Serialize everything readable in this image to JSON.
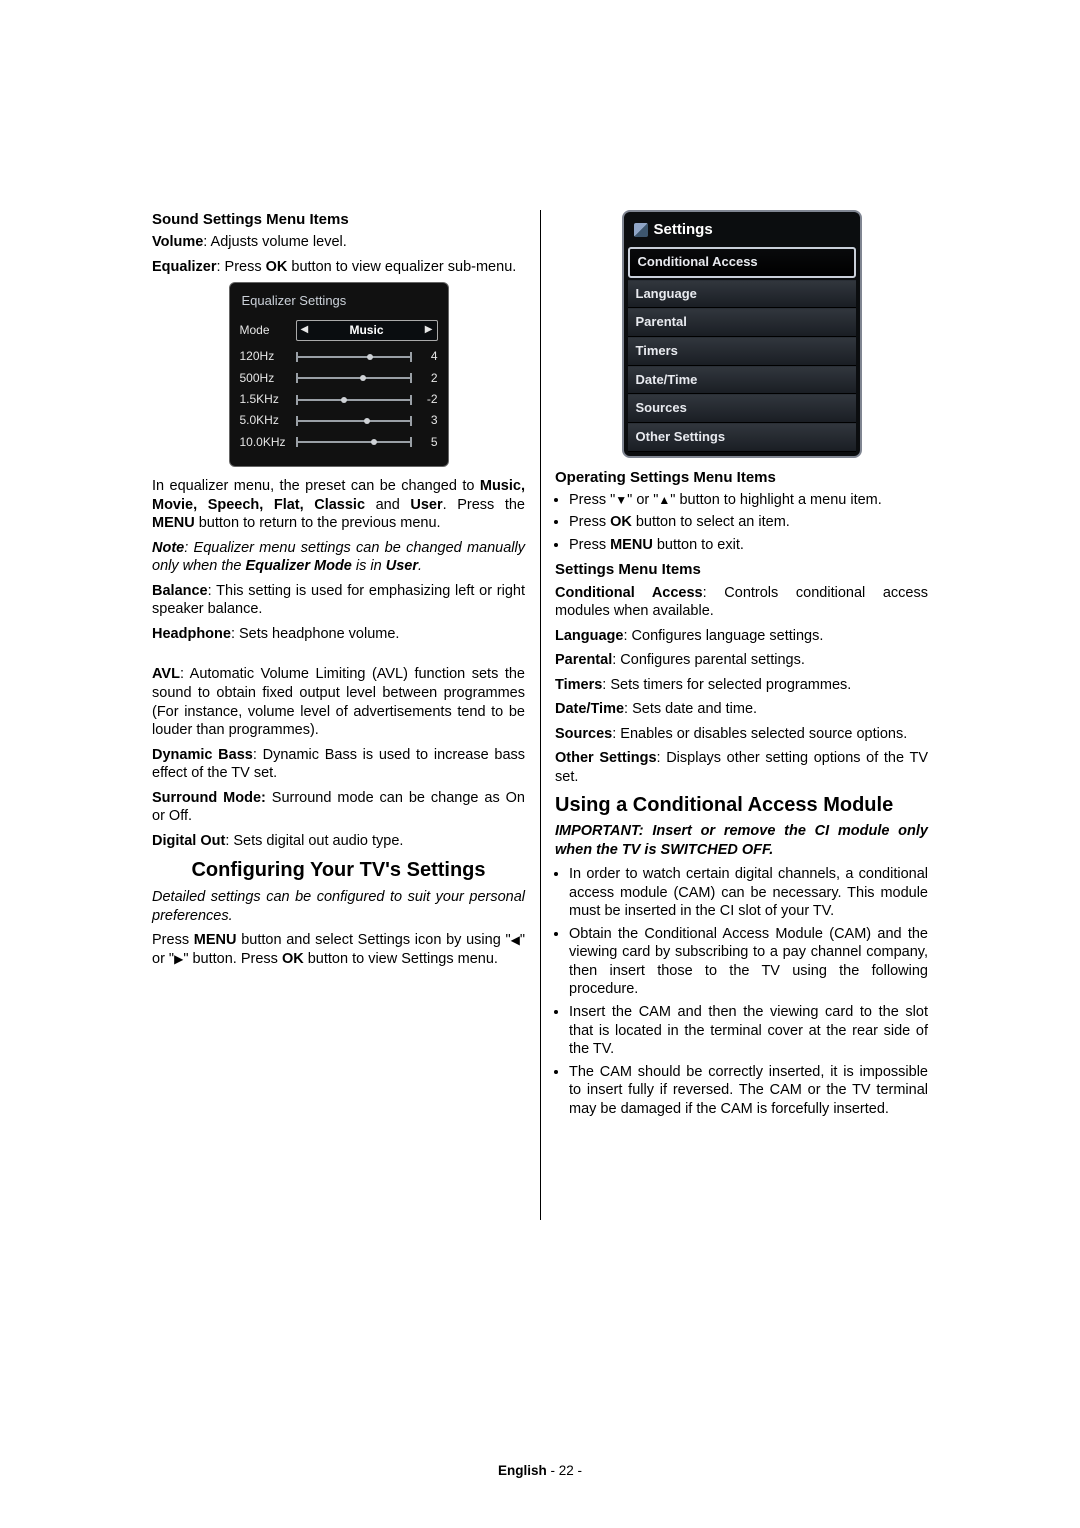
{
  "leftCol": {
    "subhead1": "Sound Settings Menu Items",
    "volume": {
      "label": "Volume",
      "desc": ": Adjusts volume level."
    },
    "equalizer": {
      "label": "Equalizer",
      "mid": ": Press ",
      "ok": "OK",
      "desc": " button to view equalizer sub-menu."
    },
    "eqOsd": {
      "title": "Equalizer Settings",
      "modeLabel": "Mode",
      "modeValue": "Music",
      "bands": [
        {
          "label": "120Hz",
          "value": 4,
          "pos": 64
        },
        {
          "label": "500Hz",
          "value": 2,
          "pos": 58
        },
        {
          "label": "1.5KHz",
          "value": -2,
          "pos": 42
        },
        {
          "label": "5.0KHz",
          "value": 3,
          "pos": 62
        },
        {
          "label": "10.0KHz",
          "value": 5,
          "pos": 68
        }
      ]
    },
    "eqPara1a": "In equalizer menu, the preset can be changed to ",
    "eqPresets": "Music, Movie, Speech, Flat, Classic",
    "eqPara1b": " and ",
    "eqPresetsUser": "User",
    "eqPara1c": ". Press the ",
    "eqMenu": "MENU",
    "eqPara1d": " button to return to the previous menu.",
    "eqNote": {
      "lead": "Note",
      "midA": ": Equalizer menu settings can be changed manually only when the ",
      "mode": "Equalizer Mode",
      "midB": " is in ",
      "user": "User",
      "end": "."
    },
    "balance": {
      "label": "Balance",
      "desc": ": This setting is used for emphasizing left or right speaker balance."
    },
    "headphone": {
      "label": "Headphone",
      "desc": ": Sets headphone volume."
    },
    "avl": {
      "label": "AVL",
      "desc": ": Automatic Volume Limiting (AVL) function sets the sound to obtain fixed output level between programmes (For instance, volume level of advertisements tend to be louder than programmes)."
    },
    "dynbass": {
      "label": "Dynamic Bass",
      "desc": ": Dynamic Bass is used to increase bass effect of the TV set."
    },
    "surround": {
      "label": "Surround Mode:",
      "desc": " Surround mode can be change as On or Off."
    },
    "digital": {
      "label": "Digital Out",
      "desc": ": Sets digital out audio type."
    },
    "heading": "Configuring Your TV's Settings",
    "detailed": "Detailed settings can be configured to suit your personal preferences.",
    "pressMenuA": "Press ",
    "pressMenuB": "MENU",
    "pressMenuC": " button and select Settings icon by using \"",
    "pressMenuD": "\" or \"",
    "pressMenuE": "\" button. Press ",
    "pressMenuOK": "OK",
    "pressMenuF": " button to view Settings menu."
  },
  "rightCol": {
    "settingsOsd": {
      "title": "Settings",
      "items": [
        "Conditional Access",
        "Language",
        "Parental",
        "Timers",
        "Date/Time",
        "Sources",
        "Other Settings"
      ],
      "selectedIndex": 0
    },
    "subhead2": "Operating Settings Menu Items",
    "bullets1": [
      {
        "a": "Press \"",
        "icon1": "▼",
        "b": "\" or \"",
        "icon2": "▲",
        "c": "\" button to highlight a menu item."
      },
      {
        "a": "Press ",
        "bold": "OK",
        "c": " button to select an item."
      },
      {
        "a": "Press ",
        "bold": "MENU",
        "c": " button to exit."
      }
    ],
    "subhead3": "Settings Menu Items",
    "items": [
      {
        "label": "Conditional Access",
        "desc": ": Controls conditional access modules when available."
      },
      {
        "label": "Language",
        "desc": ": Configures language settings."
      },
      {
        "label": "Parental",
        "desc": ": Configures parental settings."
      },
      {
        "label": "Timers",
        "desc": ": Sets timers for selected programmes."
      },
      {
        "label": "Date/Time",
        "desc": ": Sets date and time."
      },
      {
        "label": "Sources",
        "desc": ": Enables or disables selected source options."
      },
      {
        "label": "Other Settings",
        "desc": ": Displays other setting options of the TV set."
      }
    ],
    "heading2": "Using a Conditional Access Module",
    "important": "IMPORTANT: Insert or remove the CI module only when the TV is SWITCHED OFF.",
    "bullets2": [
      "In order to watch certain digital channels, a conditional access module (CAM) can be necessary. This module must be inserted in the CI slot of your TV.",
      "Obtain the Conditional Access Module (CAM) and the viewing card by subscribing to a pay channel company, then insert those to the TV using the following procedure.",
      "Insert the CAM and then the viewing card to the slot that is located in the terminal cover at the rear side of the TV.",
      "The CAM should be correctly inserted, it is impossible to insert fully if reversed. The CAM or the TV terminal may be damaged if the CAM is forcefully inserted."
    ]
  },
  "footer": {
    "lang": "English",
    "sep": "   - ",
    "page": "22",
    "end": " -"
  }
}
